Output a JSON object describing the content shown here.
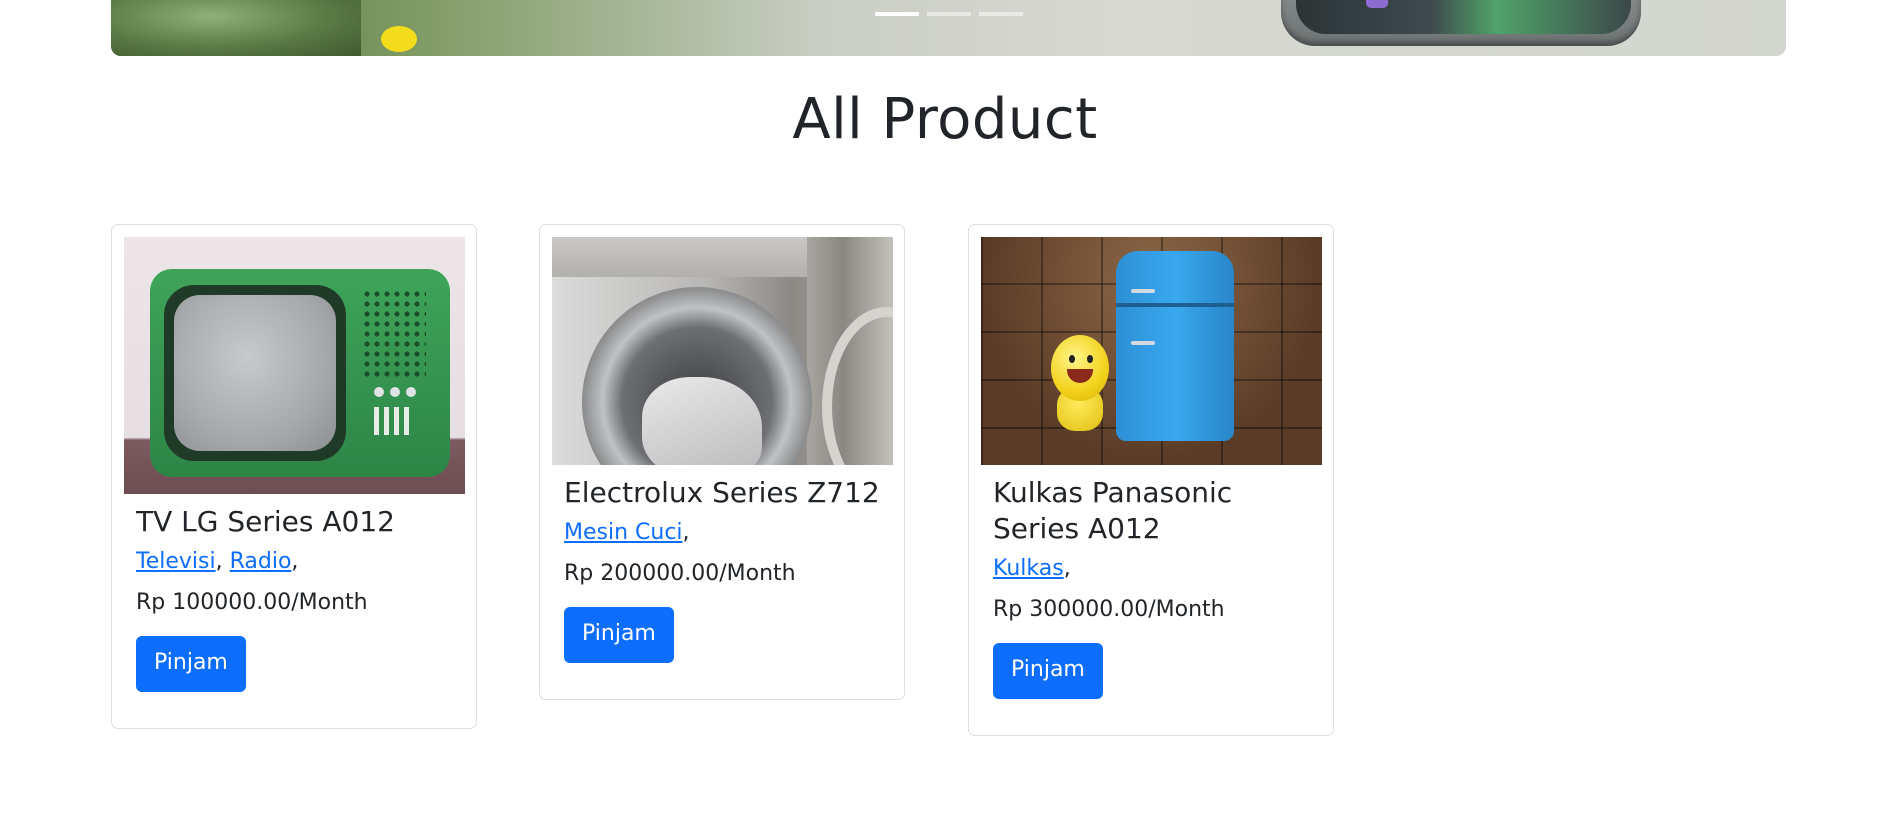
{
  "carousel": {
    "indicator_count": 3,
    "active_index": 0
  },
  "page_title": "All Product",
  "colors": {
    "primary": "#0d6efd",
    "text": "#212529",
    "card_border": "#dcdfe3"
  },
  "products": [
    {
      "name": "TV LG Series A012",
      "image": "green-retro-tv-image",
      "categories": [
        "Televisi",
        "Radio"
      ],
      "price": "Rp 100000.00/Month",
      "button_label": "Pinjam"
    },
    {
      "name": "Electrolux Series Z712",
      "image": "washing-machine-image",
      "categories": [
        "Mesin Cuci"
      ],
      "price": "Rp 200000.00/Month",
      "button_label": "Pinjam"
    },
    {
      "name": "Kulkas Panasonic Series A012",
      "image": "blue-fridge-image",
      "categories": [
        "Kulkas"
      ],
      "price": "Rp 300000.00/Month",
      "button_label": "Pinjam"
    }
  ]
}
